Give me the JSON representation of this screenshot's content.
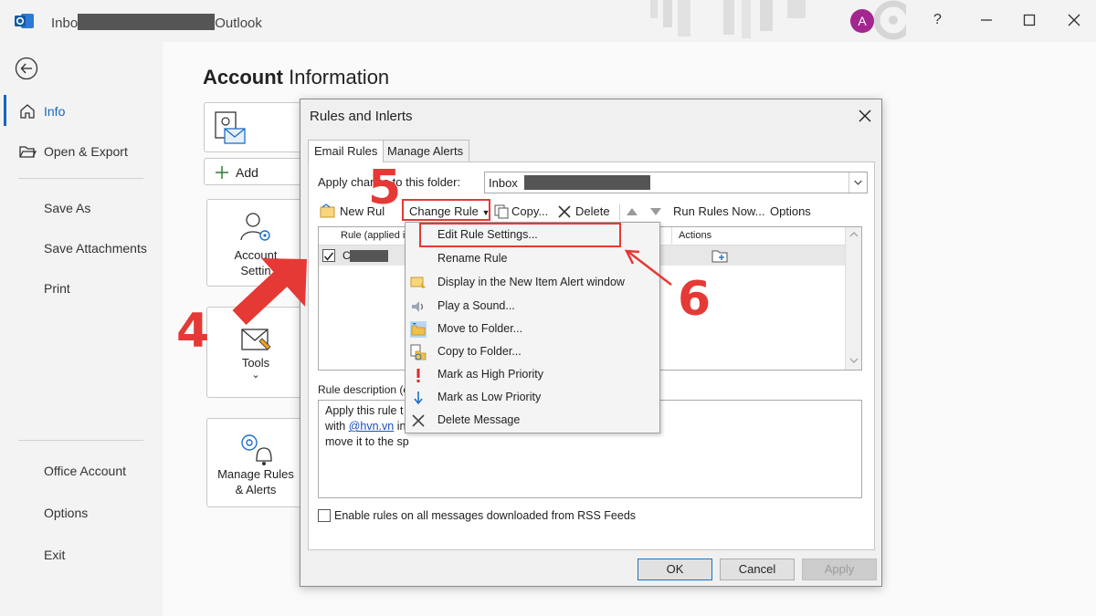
{
  "titlebar": {
    "title_prefix": "Inbo",
    "title_suffix": "Outlook",
    "avatar_initial": "A",
    "help_label": "?"
  },
  "nav": {
    "items": [
      {
        "label": "Info",
        "icon": "home-icon"
      },
      {
        "label": "Open & Export",
        "icon": "folder-open-icon"
      },
      {
        "label": "Save As"
      },
      {
        "label": "Save Attachments"
      },
      {
        "label": "Print"
      },
      {
        "label": "Office Account"
      },
      {
        "label": "Options"
      },
      {
        "label": "Exit"
      }
    ]
  },
  "page": {
    "title_bold": "Account",
    "title_rest": " Information",
    "add_label": "Add",
    "card_account_line1": "Account",
    "card_account_line2": "Settin",
    "card_tools_label": "Tools",
    "card_rules_line1": "Manage Rules",
    "card_rules_line2": "& Alerts"
  },
  "dialog": {
    "title": "Rules and Inlerts",
    "tabs": [
      {
        "label": "Email Rules",
        "active": true
      },
      {
        "label": "Manage Alerts",
        "active": false
      }
    ],
    "apply_label_a": "Apply chan",
    "apply_label_b": "es to this folder:",
    "folder_value": "Inbox",
    "toolbar": {
      "new_rule": "New Rul",
      "change_rule": "Change Rule",
      "copy": "Copy...",
      "delete": "Delete",
      "run_rules": "Run Rules Now...",
      "options": "Options"
    },
    "list": {
      "col_rule": "Rule (applied ir",
      "col_actions": "Actions",
      "row_prefix": "C"
    },
    "description": {
      "label": "Rule description (cl",
      "line1": "Apply this rule t",
      "line2_pre": "with ",
      "line2_link": "@hvn.vn",
      "line2_post": " in",
      "line3": "move it to the sp"
    },
    "rss_label": "Enable rules on all messages downloaded from RSS Feeds",
    "buttons": {
      "ok": "OK",
      "cancel": "Cancel",
      "apply": "Apply"
    }
  },
  "menu": {
    "items": [
      {
        "label": "Edit Rule Settings...",
        "icon": ""
      },
      {
        "label": "Rename Rule",
        "icon": ""
      },
      {
        "label": "Display in the New Item Alert window",
        "icon": "alert-window-icon"
      },
      {
        "label": "Play a Sound...",
        "icon": "speaker-icon"
      },
      {
        "label": "Move to Folder...",
        "icon": "move-folder-icon"
      },
      {
        "label": "Copy to Folder...",
        "icon": "copy-folder-icon"
      },
      {
        "label": "Mark as High Priority",
        "icon": "high-priority-icon"
      },
      {
        "label": "Mark as Low Priority",
        "icon": "low-priority-icon"
      },
      {
        "label": "Delete Message",
        "icon": "delete-x-icon"
      }
    ]
  },
  "annotations": {
    "step4": "4",
    "step5": "5",
    "step6": "6",
    "color": "#e53935"
  }
}
